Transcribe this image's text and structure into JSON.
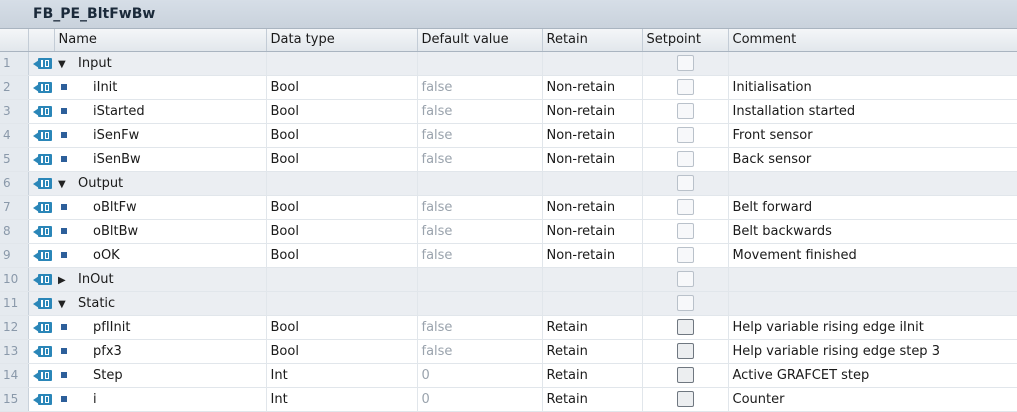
{
  "block_title": "FB_PE_BltFwBw",
  "columns": {
    "name": "Name",
    "data_type": "Data type",
    "default_value": "Default value",
    "retain": "Retain",
    "setpoint": "Setpoint",
    "comment": "Comment"
  },
  "rows": [
    {
      "num": "1",
      "kind": "section",
      "expand": "▼",
      "name": "Input",
      "type": "",
      "default": "",
      "retain": "",
      "comment": ""
    },
    {
      "num": "2",
      "kind": "var",
      "name": "iInit",
      "type": "Bool",
      "default": "false",
      "retain": "Non-retain",
      "comment": "Initialisation"
    },
    {
      "num": "3",
      "kind": "var",
      "name": "iStarted",
      "type": "Bool",
      "default": "false",
      "retain": "Non-retain",
      "comment": "Installation started"
    },
    {
      "num": "4",
      "kind": "var",
      "name": "iSenFw",
      "type": "Bool",
      "default": "false",
      "retain": "Non-retain",
      "comment": "Front sensor"
    },
    {
      "num": "5",
      "kind": "var",
      "name": "iSenBw",
      "type": "Bool",
      "default": "false",
      "retain": "Non-retain",
      "comment": "Back sensor"
    },
    {
      "num": "6",
      "kind": "section",
      "expand": "▼",
      "name": "Output",
      "type": "",
      "default": "",
      "retain": "",
      "comment": ""
    },
    {
      "num": "7",
      "kind": "var",
      "name": "oBltFw",
      "type": "Bool",
      "default": "false",
      "retain": "Non-retain",
      "comment": "Belt forward"
    },
    {
      "num": "8",
      "kind": "var",
      "name": "oBltBw",
      "type": "Bool",
      "default": "false",
      "retain": "Non-retain",
      "comment": "Belt backwards"
    },
    {
      "num": "9",
      "kind": "var",
      "name": "oOK",
      "type": "Bool",
      "default": "false",
      "retain": "Non-retain",
      "comment": "Movement finished"
    },
    {
      "num": "10",
      "kind": "section",
      "expand": "▶",
      "name": "InOut",
      "type": "",
      "default": "",
      "retain": "",
      "comment": ""
    },
    {
      "num": "11",
      "kind": "section",
      "expand": "▼",
      "name": "Static",
      "type": "",
      "default": "",
      "retain": "",
      "comment": ""
    },
    {
      "num": "12",
      "kind": "var",
      "name": "pfIInit",
      "type": "Bool",
      "default": "false",
      "retain": "Retain",
      "comment": "Help variable rising edge iInit"
    },
    {
      "num": "13",
      "kind": "var",
      "name": "pfx3",
      "type": "Bool",
      "default": "false",
      "retain": "Retain",
      "comment": "Help variable rising edge step 3"
    },
    {
      "num": "14",
      "kind": "var",
      "name": "Step",
      "type": "Int",
      "default": "0",
      "retain": "Retain",
      "comment": "Active GRAFCET step"
    },
    {
      "num": "15",
      "kind": "var",
      "name": "i",
      "type": "Int",
      "default": "0",
      "retain": "Retain",
      "comment": "Counter"
    }
  ],
  "colors": {
    "icon": "#2a86b8",
    "bullet": "#2d5f9a",
    "section_bg": "#ebeef2"
  }
}
